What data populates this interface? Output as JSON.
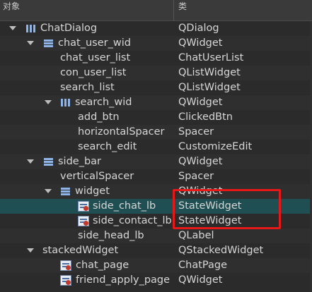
{
  "header": {
    "col_object": "对象",
    "col_class": "类"
  },
  "rows": [
    {
      "name": "ChatDialog",
      "cls": "QDialog"
    },
    {
      "name": "chat_user_wid",
      "cls": "QWidget"
    },
    {
      "name": "chat_user_list",
      "cls": "ChatUserList"
    },
    {
      "name": "con_user_list",
      "cls": "QListWidget"
    },
    {
      "name": "search_list",
      "cls": "QListWidget"
    },
    {
      "name": "search_wid",
      "cls": "QWidget"
    },
    {
      "name": "add_btn",
      "cls": "ClickedBtn"
    },
    {
      "name": "horizontalSpacer",
      "cls": "Spacer"
    },
    {
      "name": "search_edit",
      "cls": "CustomizeEdit"
    },
    {
      "name": "side_bar",
      "cls": "QWidget"
    },
    {
      "name": "verticalSpacer",
      "cls": "Spacer"
    },
    {
      "name": "widget",
      "cls": "QWidget"
    },
    {
      "name": "side_chat_lb",
      "cls": "StateWidget"
    },
    {
      "name": "side_contact_lb",
      "cls": "StateWidget"
    },
    {
      "name": "side_head_lb",
      "cls": "QLabel"
    },
    {
      "name": "stackedWidget",
      "cls": "QStackedWidget"
    },
    {
      "name": "chat_page",
      "cls": "ChatPage"
    },
    {
      "name": "friend_apply_page",
      "cls": "QWidget"
    }
  ],
  "icons": {
    "vertical_layout": "vertical-layout-icon",
    "horizontal_layout": "horizontal-layout-icon",
    "custom_widget": "widget-icon"
  },
  "colors": {
    "selection": "#1f4f52",
    "highlight_box": "#e81818"
  }
}
